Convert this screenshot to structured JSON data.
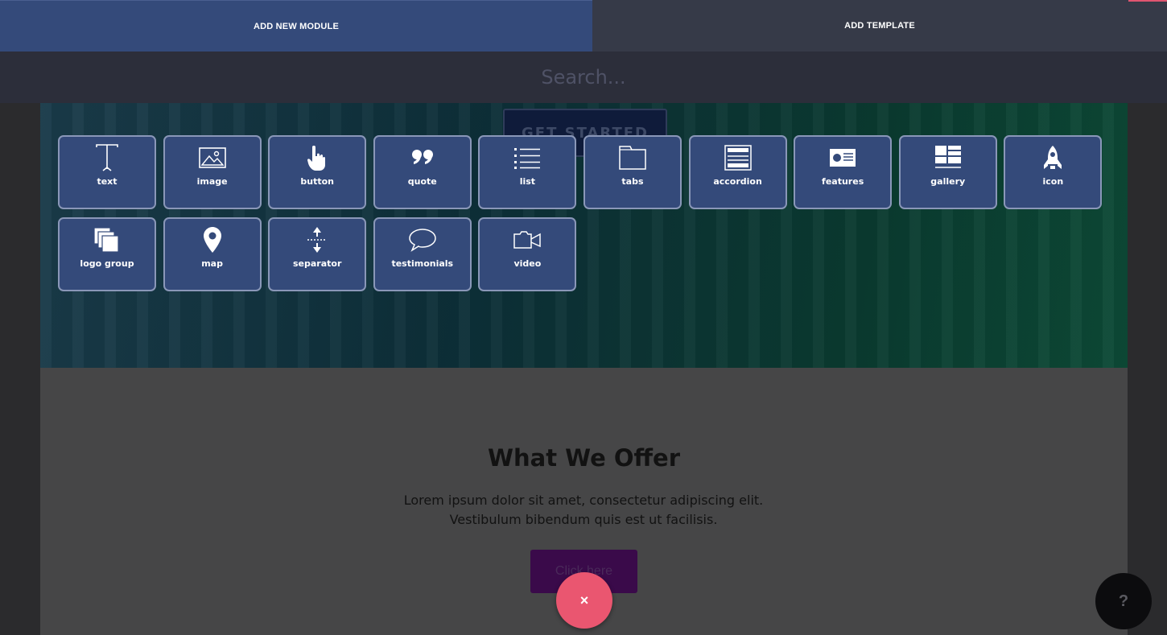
{
  "tabs": {
    "add_module": "ADD NEW MODULE",
    "add_template": "ADD TEMPLATE"
  },
  "search": {
    "placeholder": "Search..."
  },
  "modules": [
    {
      "label": "text",
      "icon": "text-cursor-icon"
    },
    {
      "label": "image",
      "icon": "image-icon"
    },
    {
      "label": "button",
      "icon": "pointer-hand-icon"
    },
    {
      "label": "quote",
      "icon": "quote-icon"
    },
    {
      "label": "list",
      "icon": "list-icon"
    },
    {
      "label": "tabs",
      "icon": "folder-tab-icon"
    },
    {
      "label": "accordion",
      "icon": "accordion-icon"
    },
    {
      "label": "features",
      "icon": "id-card-icon"
    },
    {
      "label": "gallery",
      "icon": "gallery-icon"
    },
    {
      "label": "icon",
      "icon": "rocket-icon"
    },
    {
      "label": "logo group",
      "icon": "stacked-squares-icon"
    },
    {
      "label": "map",
      "icon": "map-pin-icon"
    },
    {
      "label": "separator",
      "icon": "separator-arrows-icon"
    },
    {
      "label": "testimonials",
      "icon": "speech-bubble-icon"
    },
    {
      "label": "video",
      "icon": "video-camera-icon"
    }
  ],
  "hero": {
    "cta_label": "GET STARTED"
  },
  "offer": {
    "title": "What We Offer",
    "text": "Lorem ipsum dolor sit amet, consectetur adipiscing elit. Vestibulum bibendum quis est ut facilisis.",
    "button_label": "Click here"
  },
  "fab": {
    "close": "×",
    "help": "?"
  },
  "colors": {
    "tile_bg": "#344a7a",
    "active_tab": "#344a7a",
    "close_fab": "#ea5670"
  }
}
